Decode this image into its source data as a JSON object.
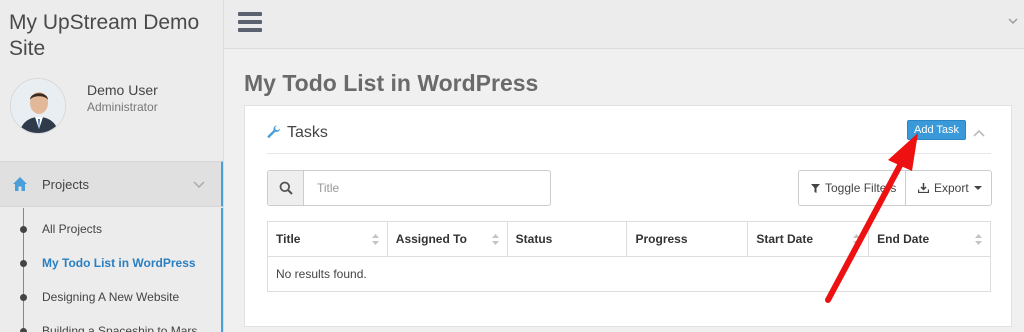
{
  "site": {
    "title": "My UpStream Demo Site"
  },
  "user": {
    "name": "Demo User",
    "role": "Administrator"
  },
  "nav": {
    "projects_label": "Projects",
    "items": [
      {
        "label": "All Projects",
        "active": false
      },
      {
        "label": "My Todo List in WordPress",
        "active": true
      },
      {
        "label": "Designing A New Website",
        "active": false
      },
      {
        "label": "Building a Spaceship to Mars",
        "active": false
      }
    ]
  },
  "page": {
    "title": "My Todo List in WordPress"
  },
  "panel": {
    "title": "Tasks",
    "add_button": "Add Task",
    "search_placeholder": "Title",
    "toggle_filters": "Toggle Filters",
    "export": "Export",
    "columns": [
      "Title",
      "Assigned To",
      "Status",
      "Progress",
      "Start Date",
      "End Date"
    ],
    "empty_message": "No results found."
  },
  "colors": {
    "accent": "#3a9ad9",
    "active_link": "#2a7fc0",
    "annotation_arrow": "#ee1111"
  },
  "icons": {
    "menu": "hamburger-icon",
    "home": "home-icon",
    "tasks": "wrench-icon",
    "search": "search-icon",
    "filter": "filter-icon",
    "export": "download-icon"
  }
}
